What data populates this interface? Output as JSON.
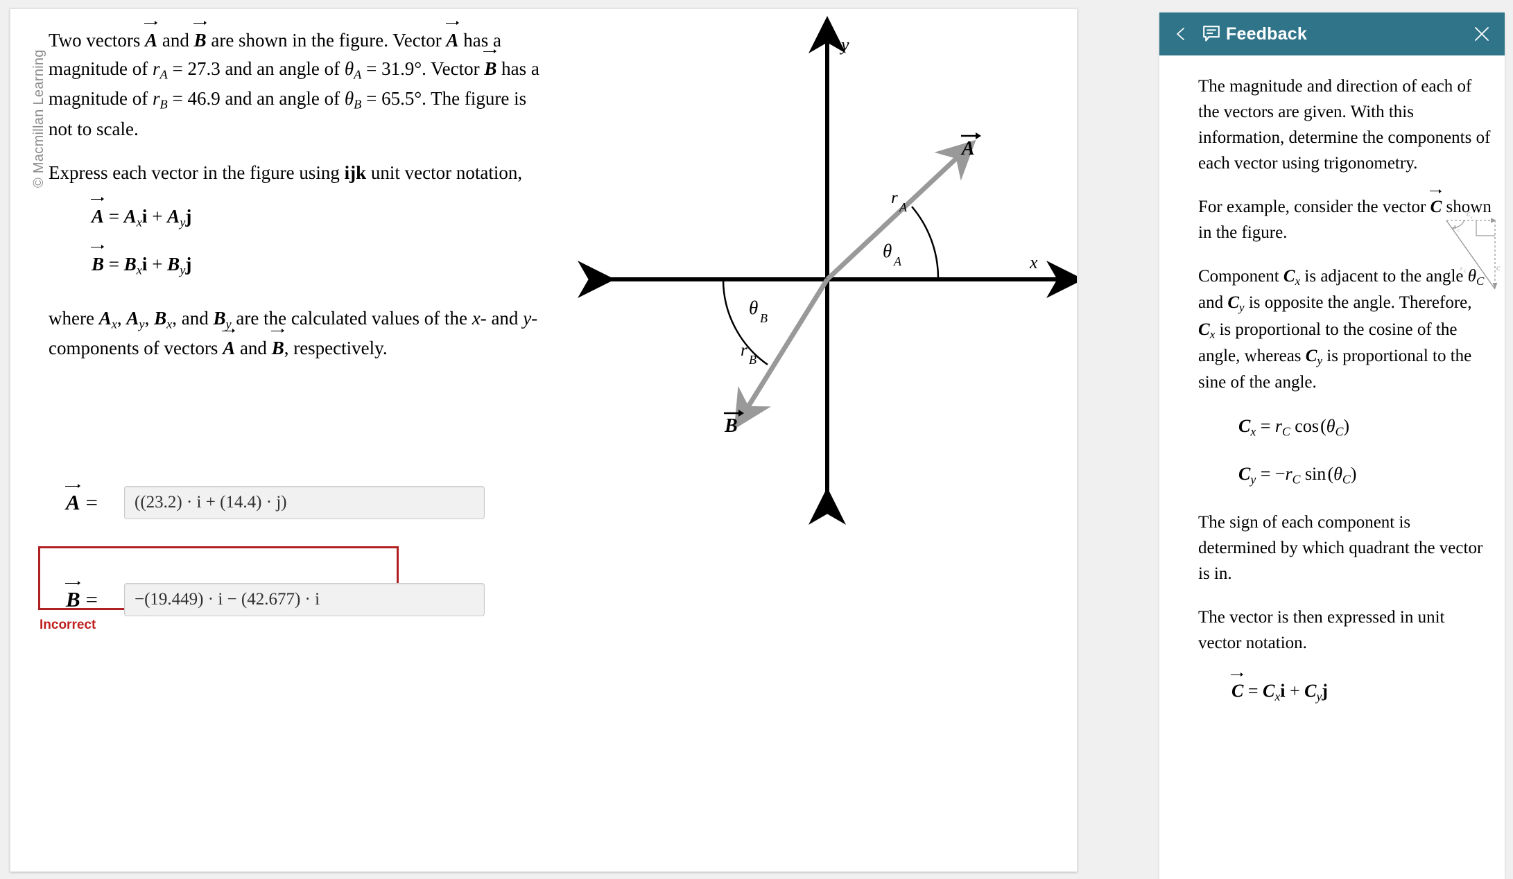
{
  "watermark": "© Macmillan Learning",
  "problem": {
    "intro_p1_a": "Two vectors ",
    "vec_a": "A",
    "intro_p1_b": " and ",
    "vec_b": "B",
    "intro_p1_c": " are shown in the figure. Vector ",
    "intro_p1_d": " has a magnitude of ",
    "r_a_symbol": "r",
    "r_a_sub": "A",
    "eq_sign": " = ",
    "r_a_value": "27.3",
    "intro_p1_e": " and an angle of ",
    "theta_symbol": "θ",
    "theta_a_sub": "A",
    "theta_a_value": "31.9°",
    "intro_p1_f": ". Vector ",
    "intro_p1_g": " has a magnitude of ",
    "r_b_symbol": "r",
    "r_b_sub": "B",
    "r_b_value": "46.9",
    "theta_b_sub": "B",
    "theta_b_value": "65.5°",
    "intro_p1_h": ". The figure is not to scale.",
    "instruction_a": "Express each vector in the figure using ",
    "instruction_bold": "ijk",
    "instruction_b": " unit vector notation,",
    "equation_a": "A = Aₓi + Aᵧj",
    "equation_b": "B = Bₓi + Bᵧj",
    "where_a": "where ",
    "where_terms": [
      "A",
      "A",
      "B",
      "B"
    ],
    "where_b": " are the calculated values of the ",
    "where_x": "x",
    "where_c": "- and ",
    "where_y": "y",
    "where_d": "-components of vectors ",
    "where_e": " and ",
    "where_f": ", respectively."
  },
  "answers": {
    "a_label": "A =",
    "a_value": "((23.2) · i + (14.4) · j)",
    "b_label": "B =",
    "b_value": "−(19.449) · i − (42.677) · i",
    "status": "Incorrect",
    "status_color": "#c0201f",
    "error_border_color": "#b02020"
  },
  "figure": {
    "axis_x_label": "x",
    "axis_y_label": "y",
    "vector_a_label": "A",
    "vector_b_label": "B",
    "r_a_label": "r",
    "r_a_sub": "A",
    "r_b_label": "r",
    "r_b_sub": "B",
    "theta_a_label": "θ",
    "theta_a_sub": "A",
    "theta_b_label": "θ",
    "theta_b_sub": "B",
    "vector_color": "#999999",
    "axis_color": "#000000"
  },
  "feedback": {
    "title": "Feedback",
    "header_color": "#2f7489",
    "back_icon": "chevron-left-icon",
    "bubble_icon": "feedback-bubble-icon",
    "close_icon": "close-icon",
    "para1": "The magnitude and direction of each of the vectors are given. With this information, determine the components of each vector using trigonometry.",
    "para2_a": "For example, consider the vector ",
    "para2_vec": "C",
    "para2_b": " shown in the figure.",
    "para3_a": "Component ",
    "para3_cx": "C",
    "para3_b": " is adjacent to the angle ",
    "para3_theta": "θ",
    "para3_c": " and ",
    "para3_cy": "C",
    "para3_d": " is opposite the angle. Therefore, ",
    "para3_e": " is proportional to the cosine of the angle, whereas ",
    "para3_f": " is proportional to the sine of the angle.",
    "eq_cx": "Cₓ = r_C cos (θ_C)",
    "eq_cy": "Cᵧ = −r_C sin (θ_C)",
    "para4": "The sign of each component is determined by which quadrant the vector is in.",
    "para5": "The vector is then expressed in unit vector notation.",
    "eq_c": "C = Cₓi + Cᵧj",
    "minifig": {
      "theta_label": "θ",
      "theta_sub": "C",
      "r_label": "r",
      "r_sub": "C",
      "cx_label": "C",
      "cx_sub": "x",
      "cy_label": "C",
      "cy_sub": "y"
    }
  }
}
